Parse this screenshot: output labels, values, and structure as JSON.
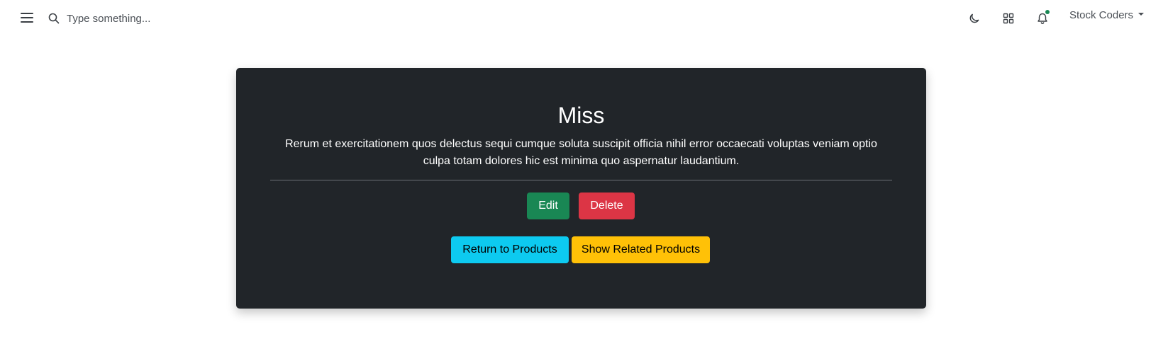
{
  "navbar": {
    "menu_icon": "hamburger-menu-icon",
    "search": {
      "placeholder": "Type something...",
      "value": ""
    },
    "icons": [
      "moon-icon",
      "grid-icon",
      "bell-icon"
    ],
    "notification_dot_color": "#198754",
    "user_label": "Stock Coders"
  },
  "product": {
    "title": "Miss",
    "description": "Rerum et exercitationem quos delectus sequi cumque soluta suscipit officia nihil error occaecati voluptas veniam optio culpa totam dolores hic est minima quo aspernatur laudantium."
  },
  "actions": {
    "edit_label": "Edit",
    "delete_label": "Delete",
    "return_label": "Return to Products",
    "related_label": "Show Related Products"
  },
  "colors": {
    "card_bg": "#212529",
    "edit": "#198754",
    "delete": "#dc3545",
    "return": "#0dcaf0",
    "related": "#ffc107"
  }
}
